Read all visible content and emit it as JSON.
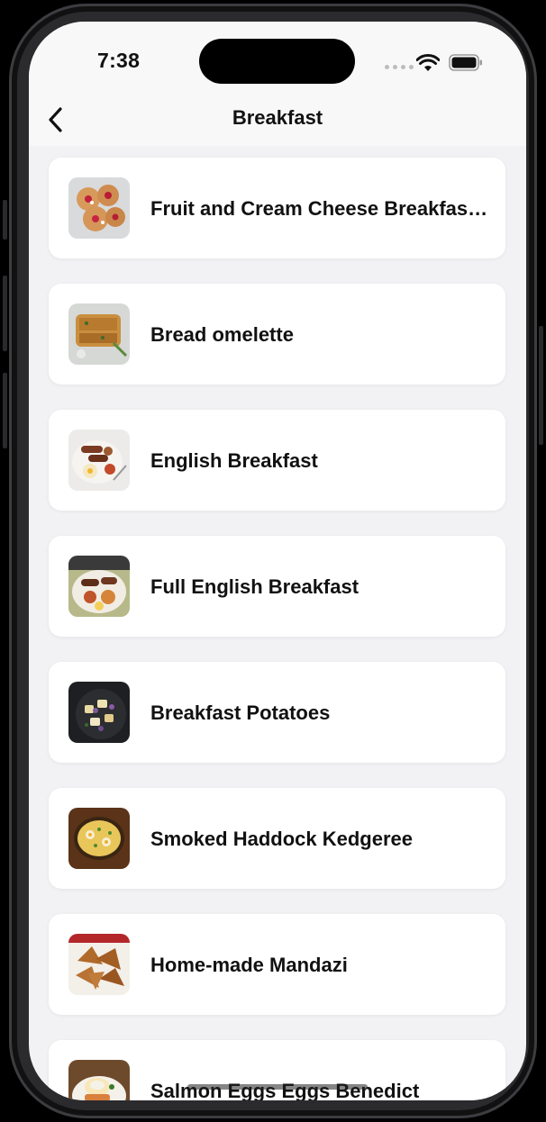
{
  "status_bar": {
    "time": "7:38",
    "icons": [
      "signal-dots-icon",
      "wifi-icon",
      "battery-icon"
    ]
  },
  "navigation": {
    "back_icon": "chevron-left-icon",
    "title": "Breakfast"
  },
  "meals": [
    {
      "name": "Fruit and Cream Cheese Breakfast Pastries",
      "thumbnail": "pastries-photo"
    },
    {
      "name": "Bread omelette",
      "thumbnail": "bread-omelette-photo"
    },
    {
      "name": "English Breakfast",
      "thumbnail": "english-breakfast-photo"
    },
    {
      "name": "Full English Breakfast",
      "thumbnail": "full-english-breakfast-photo"
    },
    {
      "name": "Breakfast Potatoes",
      "thumbnail": "breakfast-potatoes-photo"
    },
    {
      "name": "Smoked Haddock Kedgeree",
      "thumbnail": "kedgeree-photo"
    },
    {
      "name": "Home-made Mandazi",
      "thumbnail": "mandazi-photo"
    },
    {
      "name": "Salmon Eggs Eggs Benedict",
      "thumbnail": "eggs-benedict-photo"
    }
  ],
  "colors": {
    "background": "#f2f2f4",
    "card": "#ffffff",
    "text": "#111111"
  }
}
